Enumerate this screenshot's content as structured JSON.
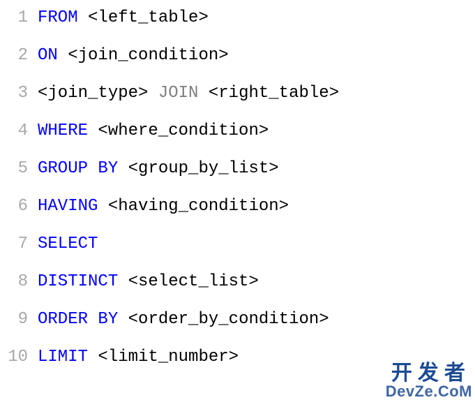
{
  "lines": [
    {
      "num": "1",
      "tokens": [
        {
          "t": "FROM",
          "c": "kw"
        },
        {
          "t": " "
        },
        {
          "t": "<left_table>",
          "c": "placeholder"
        }
      ]
    },
    {
      "num": "2",
      "tokens": [
        {
          "t": "ON",
          "c": "kw"
        },
        {
          "t": " "
        },
        {
          "t": "<join_condition>",
          "c": "placeholder"
        }
      ]
    },
    {
      "num": "3",
      "tokens": [
        {
          "t": "<join_type>",
          "c": "placeholder"
        },
        {
          "t": " "
        },
        {
          "t": "JOIN",
          "c": "join-kw"
        },
        {
          "t": " "
        },
        {
          "t": "<right_table>",
          "c": "placeholder"
        }
      ]
    },
    {
      "num": "4",
      "tokens": [
        {
          "t": "WHERE",
          "c": "kw"
        },
        {
          "t": " "
        },
        {
          "t": "<where_condition>",
          "c": "placeholder"
        }
      ]
    },
    {
      "num": "5",
      "tokens": [
        {
          "t": "GROUP",
          "c": "kw"
        },
        {
          "t": " "
        },
        {
          "t": "BY",
          "c": "kw"
        },
        {
          "t": " "
        },
        {
          "t": "<group_by_list>",
          "c": "placeholder"
        }
      ]
    },
    {
      "num": "6",
      "tokens": [
        {
          "t": "HAVING",
          "c": "kw"
        },
        {
          "t": " "
        },
        {
          "t": "<having_condition>",
          "c": "placeholder"
        }
      ]
    },
    {
      "num": "7",
      "tokens": [
        {
          "t": "SELECT",
          "c": "kw"
        }
      ]
    },
    {
      "num": "8",
      "tokens": [
        {
          "t": "DISTINCT",
          "c": "kw"
        },
        {
          "t": " "
        },
        {
          "t": "<select_list>",
          "c": "placeholder"
        }
      ]
    },
    {
      "num": "9",
      "tokens": [
        {
          "t": "ORDER",
          "c": "kw"
        },
        {
          "t": " "
        },
        {
          "t": "BY",
          "c": "kw"
        },
        {
          "t": " "
        },
        {
          "t": "<order_by_condition>",
          "c": "placeholder"
        }
      ]
    },
    {
      "num": "10",
      "tokens": [
        {
          "t": "LIMIT",
          "c": "kw"
        },
        {
          "t": " "
        },
        {
          "t": "<limit_number>",
          "c": "placeholder"
        }
      ]
    }
  ],
  "watermark": {
    "top": [
      "开",
      "发",
      "者"
    ],
    "bottom": "DevZe.CoM"
  }
}
